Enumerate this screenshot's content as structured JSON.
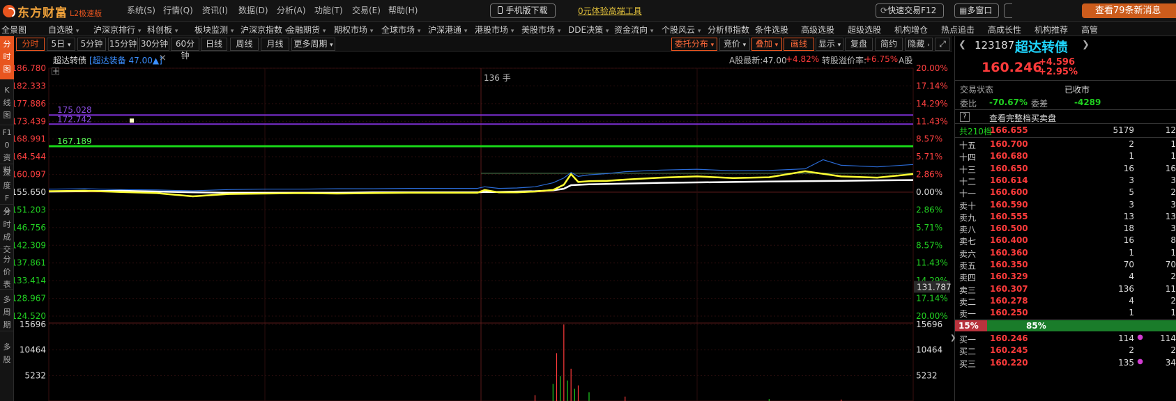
{
  "app": {
    "logo_name": "东方财富",
    "logo_version": "L2极速版",
    "menu": [
      "系统(S)",
      "行情(Q)",
      "资讯(I)",
      "数据(D)",
      "分析(A)",
      "功能(T)",
      "交易(E)",
      "帮助(H)"
    ],
    "mobile_download": "手机版下载",
    "trial_link": "0元体验高端工具",
    "quick_trade": "快速交易F12",
    "multi_window": "多窗口",
    "news": "查看79条新消息",
    "accent": "#e8551f"
  },
  "nav": {
    "items": [
      {
        "label": "全景图",
        "arrow": false
      },
      {
        "label": "自选股",
        "arrow": true
      },
      {
        "label": "沪深京排行",
        "arrow": true
      },
      {
        "label": "科创板",
        "arrow": true
      },
      {
        "label": "板块监测",
        "arrow": true
      },
      {
        "label": "沪深京指数",
        "arrow": true
      },
      {
        "label": "金融期货",
        "arrow": true
      },
      {
        "label": "期权市场",
        "arrow": true
      },
      {
        "label": "全球市场",
        "arrow": true
      },
      {
        "label": "沪深港通",
        "arrow": true
      },
      {
        "label": "港股市场",
        "arrow": true
      },
      {
        "label": "美股市场",
        "arrow": true
      },
      {
        "label": "DDE决策",
        "arrow": true
      },
      {
        "label": "资金流向",
        "arrow": true
      },
      {
        "label": "个股风云",
        "arrow": true
      },
      {
        "label": "分析师指数",
        "arrow": false
      },
      {
        "label": "条件选股",
        "arrow": false
      },
      {
        "label": "高级选股",
        "arrow": false
      },
      {
        "label": "超级选股",
        "arrow": false
      },
      {
        "label": "机构增仓",
        "arrow": false
      },
      {
        "label": "热点追击",
        "arrow": false
      },
      {
        "label": "高成长性",
        "arrow": false
      },
      {
        "label": "机构推荐",
        "arrow": false
      },
      {
        "label": "高管",
        "arrow": false
      }
    ]
  },
  "leftbar": [
    "分时图",
    "K线图",
    "F10资料",
    "深度F9",
    "分时成交",
    "分价表",
    "多周期",
    "多股"
  ],
  "periods": {
    "left": [
      "分时",
      "5日",
      "5分钟",
      "15分钟",
      "30分钟",
      "60分钟",
      "日线",
      "周线",
      "月线",
      "更多周期"
    ],
    "right": [
      "委托分布",
      "竞价",
      "叠加",
      "画线",
      "显示",
      "复盘",
      "简约",
      "隐藏"
    ]
  },
  "chart_header": {
    "name": "超达转债",
    "overlay": "[超达装备 47.00▲]",
    "a_share_latest": "A股最新:47.00",
    "a_share_change": "+4.82%",
    "premium_label": "转股溢价率:",
    "premium_value": "+6.75%",
    "a_label": "A股",
    "hand": "136 手"
  },
  "chart_data": {
    "type": "line",
    "title": "超达转债",
    "price_ticks": [
      "186.780",
      "182.333",
      "177.886",
      "173.439",
      "168.991",
      "164.544",
      "160.097",
      "155.650",
      "151.203",
      "146.756",
      "142.309",
      "137.861",
      "133.414",
      "128.967",
      "124.520"
    ],
    "pct_ticks": [
      "20.00%",
      "17.14%",
      "14.29%",
      "11.43%",
      "8.57%",
      "5.71%",
      "2.86%",
      "0.00%",
      "2.86%",
      "5.71%",
      "8.57%",
      "11.43%",
      "14.29%",
      "17.14%",
      "20.00%"
    ],
    "ylim": [
      124.52,
      186.78
    ],
    "prev_close": 155.65,
    "reference_lines": [
      {
        "label": "175.028",
        "value": 175.028,
        "color": "#7b2fd0"
      },
      {
        "label": "172.742",
        "value": 172.742,
        "color": "#7b2fd0"
      },
      {
        "label": "167.189",
        "value": 167.189,
        "color": "#18d818"
      }
    ],
    "hover_price": "131.787",
    "x_range": [
      0,
      240
    ],
    "series": [
      {
        "name": "",
        "color": "#ffffff",
        "x": [
          0,
          10,
          20,
          30,
          40,
          50,
          60,
          70,
          80,
          90,
          100,
          110,
          119,
          121,
          125,
          130,
          135,
          140,
          143,
          145,
          150,
          160,
          170,
          180,
          190,
          200,
          210,
          220,
          230,
          240
        ],
        "y": [
          155.8,
          155.9,
          156.0,
          155.8,
          155.6,
          155.5,
          155.5,
          155.5,
          155.5,
          155.6,
          155.6,
          155.6,
          155.6,
          155.7,
          155.7,
          155.8,
          155.9,
          156.1,
          156.5,
          157.4,
          157.6,
          157.8,
          158.0,
          158.1,
          158.2,
          158.3,
          158.4,
          158.5,
          158.6,
          158.7
        ]
      },
      {
        "name": "",
        "color": "#ffff33",
        "x": [
          0,
          10,
          20,
          30,
          40,
          50,
          60,
          70,
          80,
          90,
          100,
          110,
          119,
          121,
          125,
          130,
          135,
          140,
          143,
          145,
          147,
          150,
          155,
          160,
          170,
          180,
          190,
          200,
          210,
          220,
          230,
          240
        ],
        "y": [
          155.9,
          156.0,
          155.7,
          155.4,
          154.6,
          155.2,
          155.3,
          155.4,
          155.3,
          155.4,
          155.5,
          155.5,
          155.5,
          156.2,
          155.6,
          155.6,
          155.8,
          156.2,
          157.5,
          160.2,
          158.2,
          158.4,
          158.5,
          158.8,
          159.3,
          159.6,
          159.2,
          159.4,
          160.9,
          159.6,
          159.3,
          160.2
        ]
      },
      {
        "name": "",
        "color": "#2a6bd6",
        "x": [
          0,
          10,
          20,
          30,
          40,
          50,
          60,
          70,
          80,
          90,
          100,
          110,
          119,
          121,
          125,
          130,
          135,
          140,
          143,
          145,
          147,
          150,
          155,
          160,
          170,
          180,
          190,
          200,
          210,
          215,
          220,
          230,
          240
        ],
        "y": [
          156.4,
          156.5,
          156.3,
          156.2,
          156.0,
          156.3,
          156.4,
          156.4,
          156.5,
          156.5,
          156.6,
          156.6,
          156.6,
          157.0,
          156.6,
          156.7,
          157.0,
          158.0,
          159.2,
          160.6,
          159.6,
          160.0,
          160.3,
          160.8,
          161.2,
          161.4,
          161.0,
          161.1,
          161.5,
          163.8,
          162.4,
          162.0,
          162.6
        ]
      }
    ],
    "volume": {
      "ticks": [
        "15696",
        "10464",
        "5232"
      ],
      "max": 15696,
      "x": [
        135,
        140,
        141,
        142,
        143,
        144,
        145,
        146,
        147,
        150,
        160,
        200,
        220
      ],
      "values": [
        1200,
        3500,
        9800,
        5100,
        15696,
        4200,
        6600,
        2500,
        3200,
        1800,
        900,
        400,
        300
      ]
    }
  },
  "quote": {
    "code": "123187",
    "name": "超达转债",
    "price": "160.246",
    "change": "+4.596",
    "change_pct": "+2.95%",
    "status_label": "交易状态",
    "status_value": "已收市",
    "weibi_label": "委比",
    "weibi_value": "-70.67%",
    "weicha_label": "委差",
    "weicha_value": "-4289",
    "full_book": "查看完整档买卖盘",
    "total_levels": "共210档",
    "total_price": "166.655",
    "total_vol": "5179",
    "total_extra": "12",
    "sells": [
      {
        "label": "十五",
        "price": "160.700",
        "vol": "2",
        "extra": "1"
      },
      {
        "label": "十四",
        "price": "160.680",
        "vol": "1",
        "extra": "1"
      },
      {
        "label": "十三",
        "price": "160.650",
        "vol": "16",
        "extra": "16"
      },
      {
        "label": "十二",
        "price": "160.614",
        "vol": "3",
        "extra": "3"
      },
      {
        "label": "十一",
        "price": "160.600",
        "vol": "5",
        "extra": "2"
      },
      {
        "label": "卖十",
        "price": "160.590",
        "vol": "3",
        "extra": "3"
      },
      {
        "label": "卖九",
        "price": "160.555",
        "vol": "13",
        "extra": "13"
      },
      {
        "label": "卖八",
        "price": "160.500",
        "vol": "18",
        "extra": "3"
      },
      {
        "label": "卖七",
        "price": "160.400",
        "vol": "16",
        "extra": "8"
      },
      {
        "label": "卖六",
        "price": "160.360",
        "vol": "1",
        "extra": "1"
      },
      {
        "label": "卖五",
        "price": "160.350",
        "vol": "70",
        "extra": "70"
      },
      {
        "label": "卖四",
        "price": "160.329",
        "vol": "4",
        "extra": "2"
      },
      {
        "label": "卖三",
        "price": "160.307",
        "vol": "136",
        "extra": "11"
      },
      {
        "label": "卖二",
        "price": "160.278",
        "vol": "4",
        "extra": "2"
      },
      {
        "label": "卖一",
        "price": "160.250",
        "vol": "1",
        "extra": "1"
      }
    ],
    "ratio_left": "15%",
    "ratio_right": "85%",
    "buys": [
      {
        "label": "买一",
        "price": "160.246",
        "vol": "114",
        "extra": "114",
        "dot": true
      },
      {
        "label": "买二",
        "price": "160.245",
        "vol": "2",
        "extra": "2",
        "dot": false
      },
      {
        "label": "买三",
        "price": "160.220",
        "vol": "135",
        "extra": "34",
        "dot": true
      }
    ]
  }
}
